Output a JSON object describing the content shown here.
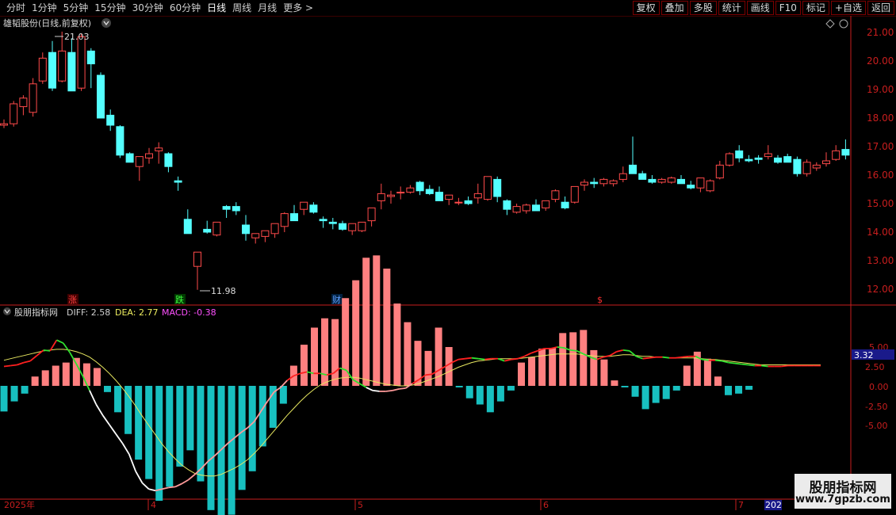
{
  "toolbar": {
    "tabs": [
      "分时",
      "1分钟",
      "5分钟",
      "15分钟",
      "30分钟",
      "60分钟",
      "日线",
      "周线",
      "月线",
      "更多"
    ],
    "active_tab": "日线",
    "more_arrow": ">",
    "right_buttons": [
      "复权",
      "叠加",
      "多股",
      "统计",
      "画线",
      "F10",
      "标记",
      "+自选",
      "返回"
    ]
  },
  "main_chart": {
    "stock_title": "雄韬股份(日线,前复权)",
    "dropdown_icon": "chevron-down-icon",
    "price_axis": [
      "21.00",
      "20.00",
      "19.00",
      "18.00",
      "17.00",
      "16.00",
      "15.00",
      "14.00",
      "13.00",
      "12.00"
    ],
    "high_label": "21.03",
    "low_label": "11.98",
    "markers": [
      {
        "text": "涨",
        "color": "#ff4040",
        "bg": "#400000"
      },
      {
        "text": "跌",
        "color": "#40ff40",
        "bg": "#003a00"
      },
      {
        "text": "财",
        "color": "#60a0ff",
        "bg": "#002040"
      },
      {
        "text": "$",
        "color": "#ff3030",
        "bg": "#000000"
      }
    ]
  },
  "indicator": {
    "name": "股朋指标网",
    "diff_label": "DIFF: 2.58",
    "dea_label": "DEA: 2.77",
    "macd_label": "MACD: -0.38",
    "axis": [
      "5.00",
      "2.50",
      "0.00",
      "-2.50",
      "-5.00"
    ],
    "current_value": "3.32"
  },
  "time_axis": {
    "labels": [
      "2025年",
      "4",
      "5",
      "6",
      "7"
    ],
    "cut_label": "202"
  },
  "watermark": {
    "line1": "股朋指标网",
    "line2": "www.7gpzb.com"
  },
  "colors": {
    "up": "#ff4a4a",
    "down": "#54ffff",
    "axis": "#c81e1e",
    "dea": "#e8e860",
    "macd_pos": "#ff8080",
    "macd_neg": "#18c0c0",
    "diff_label": "#d0d0d0",
    "dea_label_color": "#f0f060",
    "macd_label_color": "#ff50ff"
  },
  "chart_data": {
    "type": "candlestick",
    "candles": [
      [
        17.75,
        17.95,
        17.65,
        17.8
      ],
      [
        17.8,
        18.6,
        17.7,
        18.5
      ],
      [
        18.4,
        18.8,
        18.1,
        18.7
      ],
      [
        18.2,
        19.4,
        18.05,
        19.2
      ],
      [
        19.3,
        20.3,
        19.2,
        20.1
      ],
      [
        20.3,
        20.7,
        18.95,
        19.05
      ],
      [
        19.3,
        21.03,
        19.25,
        20.35
      ],
      [
        20.3,
        20.8,
        18.95,
        18.95
      ],
      [
        19.05,
        20.95,
        18.95,
        20.85
      ],
      [
        20.35,
        20.45,
        19.05,
        19.9
      ],
      [
        19.5,
        19.6,
        18.1,
        18.0
      ],
      [
        18.1,
        18.3,
        17.55,
        17.75
      ],
      [
        17.7,
        17.75,
        16.6,
        16.7
      ],
      [
        16.75,
        16.8,
        16.45,
        16.45
      ],
      [
        16.3,
        16.55,
        15.8,
        16.65
      ],
      [
        16.6,
        16.95,
        16.4,
        16.75
      ],
      [
        16.85,
        17.15,
        16.4,
        16.95
      ],
      [
        16.75,
        16.8,
        16.1,
        16.3
      ],
      [
        15.8,
        15.95,
        15.45,
        15.75
      ],
      [
        14.45,
        14.8,
        14.25,
        13.95
      ],
      [
        12.8,
        13.3,
        11.98,
        13.3
      ],
      [
        14.1,
        14.4,
        13.95,
        14.0
      ],
      [
        13.9,
        14.25,
        13.85,
        14.35
      ],
      [
        14.9,
        14.95,
        14.5,
        14.8
      ],
      [
        14.9,
        15.05,
        14.6,
        14.75
      ],
      [
        14.25,
        14.6,
        13.7,
        13.95
      ],
      [
        13.8,
        13.95,
        13.6,
        13.95
      ],
      [
        13.85,
        13.95,
        13.65,
        14.05
      ],
      [
        13.95,
        14.2,
        13.8,
        14.3
      ],
      [
        14.2,
        14.7,
        14.0,
        14.65
      ],
      [
        14.65,
        14.95,
        14.45,
        14.4
      ],
      [
        14.8,
        15.05,
        14.6,
        15.05
      ],
      [
        14.95,
        15.05,
        14.65,
        14.7
      ],
      [
        14.45,
        14.55,
        14.15,
        14.4
      ],
      [
        14.35,
        14.5,
        14.1,
        14.3
      ],
      [
        14.3,
        14.4,
        14.05,
        14.1
      ],
      [
        14.05,
        14.25,
        13.9,
        14.3
      ],
      [
        14.05,
        14.35,
        14.0,
        14.35
      ],
      [
        14.4,
        14.65,
        14.2,
        14.85
      ],
      [
        15.1,
        15.7,
        14.8,
        15.35
      ],
      [
        15.25,
        15.45,
        15.0,
        15.3
      ],
      [
        15.4,
        15.6,
        15.15,
        15.4
      ],
      [
        15.4,
        15.65,
        15.35,
        15.55
      ],
      [
        15.75,
        15.8,
        15.3,
        15.45
      ],
      [
        15.5,
        15.65,
        15.3,
        15.35
      ],
      [
        15.4,
        15.6,
        15.25,
        15.1
      ],
      [
        15.15,
        15.3,
        14.95,
        15.3
      ],
      [
        15.05,
        15.2,
        14.95,
        15.05
      ],
      [
        15.1,
        15.25,
        14.95,
        15.0
      ],
      [
        15.2,
        15.7,
        15.0,
        15.35
      ],
      [
        15.15,
        15.95,
        15.1,
        15.95
      ],
      [
        15.85,
        15.95,
        15.05,
        15.25
      ],
      [
        15.1,
        15.15,
        14.6,
        14.8
      ],
      [
        14.7,
        15.0,
        14.65,
        14.9
      ],
      [
        14.75,
        15.0,
        14.65,
        14.95
      ],
      [
        14.95,
        15.15,
        14.8,
        14.75
      ],
      [
        14.85,
        15.1,
        14.75,
        15.1
      ],
      [
        15.15,
        15.5,
        15.05,
        15.45
      ],
      [
        15.05,
        15.25,
        14.8,
        14.85
      ],
      [
        15.05,
        15.5,
        15.0,
        15.6
      ],
      [
        15.65,
        15.85,
        15.45,
        15.75
      ],
      [
        15.75,
        15.9,
        15.55,
        15.7
      ],
      [
        15.7,
        15.9,
        15.6,
        15.85
      ],
      [
        15.7,
        15.85,
        15.6,
        15.8
      ],
      [
        15.85,
        16.3,
        15.75,
        16.05
      ],
      [
        16.35,
        17.35,
        16.3,
        16.05
      ],
      [
        16.05,
        16.15,
        15.85,
        15.85
      ],
      [
        15.85,
        16.0,
        15.7,
        15.75
      ],
      [
        15.75,
        15.9,
        15.7,
        15.85
      ],
      [
        15.75,
        15.95,
        15.7,
        15.9
      ],
      [
        15.85,
        16.0,
        15.8,
        15.7
      ],
      [
        15.65,
        15.8,
        15.5,
        15.55
      ],
      [
        15.55,
        15.75,
        15.4,
        15.9
      ],
      [
        15.45,
        15.85,
        15.4,
        15.8
      ],
      [
        15.9,
        16.5,
        15.85,
        16.35
      ],
      [
        16.35,
        16.8,
        16.3,
        16.75
      ],
      [
        16.85,
        17.05,
        16.45,
        16.6
      ],
      [
        16.55,
        16.7,
        16.45,
        16.5
      ],
      [
        16.6,
        16.7,
        16.4,
        16.55
      ],
      [
        16.65,
        17.05,
        16.55,
        16.75
      ],
      [
        16.6,
        16.7,
        16.4,
        16.45
      ],
      [
        16.65,
        16.75,
        16.45,
        16.45
      ],
      [
        16.55,
        16.65,
        15.95,
        16.05
      ],
      [
        16.05,
        16.55,
        15.95,
        16.45
      ],
      [
        16.25,
        16.45,
        16.15,
        16.35
      ],
      [
        16.4,
        16.8,
        16.3,
        16.5
      ],
      [
        16.55,
        17.05,
        16.5,
        16.85
      ],
      [
        16.9,
        17.25,
        16.55,
        16.7
      ]
    ],
    "macd": {
      "diff": [
        2.5,
        2.6,
        2.7,
        3.0,
        3.2,
        3.9,
        4.6,
        4.5,
        5.9,
        5.5,
        4.3,
        2.8,
        1.2,
        -0.6,
        -2.4,
        -3.8,
        -5.0,
        -6.2,
        -7.4,
        -8.8,
        -11.0,
        -12.5,
        -13.3,
        -13.5,
        -13.3,
        -13.1,
        -13.0,
        -12.6,
        -12.1,
        -11.4,
        -10.6,
        -9.7,
        -9.0,
        -8.2,
        -7.4,
        -6.7,
        -6.0,
        -5.4,
        -4.6,
        -3.3,
        -2.0,
        -0.8,
        -0.2,
        0.7,
        1.3,
        1.6,
        1.8,
        1.6,
        1.6,
        1.4,
        1.6,
        2.3,
        2.0,
        0.8,
        0.3,
        -0.2,
        -0.6,
        -0.7,
        -0.7,
        -0.6,
        -0.4,
        -0.3,
        0.3,
        0.8,
        1.4,
        1.5,
        2.0,
        2.5,
        3.0,
        3.4,
        3.5,
        3.6,
        3.5,
        3.4,
        3.5,
        3.5,
        3.2,
        3.4,
        3.5,
        3.8,
        4.2,
        4.5,
        4.8,
        4.8,
        5.0,
        4.9,
        4.6,
        4.5,
        4.1,
        3.7,
        3.4,
        3.7,
        3.9,
        4.4,
        4.6,
        4.5,
        3.8,
        3.5,
        3.6,
        3.7,
        3.7,
        3.6,
        3.6,
        3.7,
        3.8,
        3.8,
        3.4,
        3.3,
        3.3,
        3.2,
        3.0,
        2.9,
        2.8,
        2.7,
        2.6,
        2.6,
        2.5,
        2.5,
        2.5,
        2.6,
        2.6,
        2.6,
        2.6,
        2.6,
        2.6
      ],
      "dea": [
        3.3,
        3.5,
        3.7,
        3.9,
        4.1,
        4.3,
        4.5,
        4.6,
        4.7,
        4.7,
        4.6,
        4.4,
        4.1,
        3.7,
        3.1,
        2.4,
        1.6,
        0.7,
        -0.3,
        -1.4,
        -2.6,
        -3.9,
        -5.1,
        -6.3,
        -7.5,
        -8.5,
        -9.4,
        -10.2,
        -10.8,
        -11.3,
        -11.5,
        -11.6,
        -11.6,
        -11.4,
        -11.0,
        -10.6,
        -10.1,
        -9.5,
        -8.7,
        -7.8,
        -6.8,
        -5.8,
        -4.8,
        -3.8,
        -2.9,
        -2.0,
        -1.2,
        -0.5,
        0.1,
        0.5,
        0.8,
        1.0,
        1.1,
        1.1,
        1.0,
        0.8,
        0.6,
        0.4,
        0.2,
        0.1,
        0.0,
        0.0,
        0.1,
        0.3,
        0.6,
        0.9,
        1.2,
        1.6,
        2.0,
        2.4,
        2.7,
        3.0,
        3.2,
        3.3,
        3.4,
        3.5,
        3.5,
        3.5,
        3.5,
        3.6,
        3.7,
        3.8,
        3.9,
        4.0,
        4.1,
        4.1,
        4.1,
        4.1,
        4.0,
        3.9,
        3.8,
        3.8,
        3.8,
        3.9,
        4.0,
        4.0,
        3.9,
        3.8,
        3.8,
        3.7,
        3.7,
        3.6,
        3.6,
        3.6,
        3.6,
        3.6,
        3.5,
        3.4,
        3.4,
        3.3,
        3.2,
        3.1,
        3.0,
        2.9,
        2.8,
        2.7,
        2.7,
        2.7,
        2.7,
        2.7,
        2.7,
        2.7,
        2.7,
        2.7,
        2.7
      ],
      "macd": [
        -3.3,
        -2.0,
        -1.0,
        1.2,
        2.0,
        2.6,
        3.0,
        3.6,
        2.9,
        2.3,
        -0.8,
        -3.4,
        -6.2,
        -9.5,
        -12.0,
        -14.8,
        -13.0,
        -10.4,
        -8.3,
        -12.3,
        -16.0,
        -17.4,
        -16.6,
        -13.4,
        -11.0,
        -7.8,
        -5.4,
        -2.3,
        2.6,
        5.3,
        7.5,
        8.7,
        8.6,
        11.3,
        13.6,
        16.5,
        16.8,
        15.1,
        10.6,
        8.2,
        5.8,
        4.5,
        7.5,
        5.0,
        -0.2,
        -1.6,
        -2.4,
        -3.4,
        -2.0,
        -0.6,
        3.0,
        3.7,
        4.8,
        4.9,
        6.8,
        6.9,
        7.2,
        4.6,
        3.4,
        0.7,
        -0.2,
        -1.4,
        -3.0,
        -2.2,
        -1.7,
        -0.6,
        2.6,
        4.4,
        3.5,
        1.2,
        -1.2,
        -1.0,
        -0.5
      ],
      "ylim": [
        -14,
        8
      ]
    }
  }
}
